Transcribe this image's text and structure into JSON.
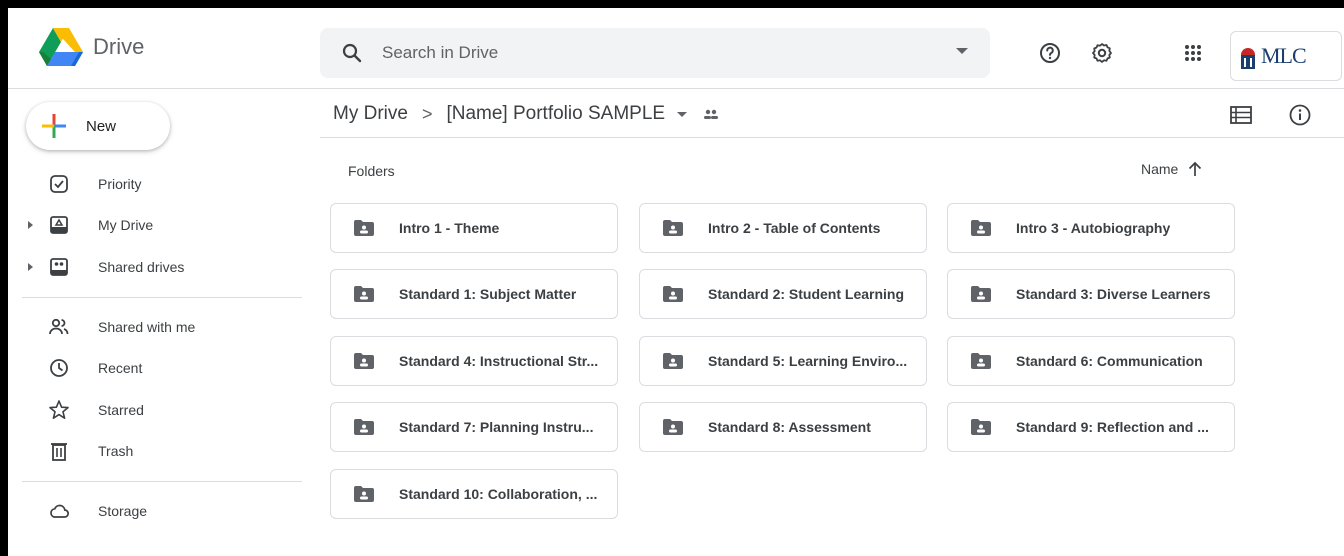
{
  "app": {
    "name": "Drive"
  },
  "search": {
    "placeholder": "Search in Drive"
  },
  "account": {
    "label": "MLC"
  },
  "new_button": {
    "label": "New"
  },
  "sidebar": {
    "items": [
      {
        "label": "Priority",
        "icon": "priority-icon"
      },
      {
        "label": "My Drive",
        "icon": "my-drive-icon"
      },
      {
        "label": "Shared drives",
        "icon": "shared-drives-icon"
      },
      {
        "label": "Shared with me",
        "icon": "shared-with-me-icon"
      },
      {
        "label": "Recent",
        "icon": "recent-icon"
      },
      {
        "label": "Starred",
        "icon": "star-icon"
      },
      {
        "label": "Trash",
        "icon": "trash-icon"
      },
      {
        "label": "Storage",
        "icon": "cloud-icon"
      }
    ]
  },
  "breadcrumb": {
    "root": "My Drive",
    "separator": ">",
    "current": "[Name] Portfolio SAMPLE"
  },
  "folders_section": {
    "title": "Folders",
    "sort_label": "Name"
  },
  "folders": [
    "Intro 1 - Theme",
    "Intro 2 - Table of Contents",
    "Intro 3 - Autobiography",
    "Standard 1: Subject Matter",
    "Standard 2: Student Learning",
    "Standard 3: Diverse Learners",
    "Standard 4: Instructional Str...",
    "Standard 5: Learning Enviro...",
    "Standard 6: Communication",
    "Standard 7: Planning Instru...",
    "Standard 8: Assessment",
    "Standard 9: Reflection and ...",
    "Standard 10: Collaboration, ..."
  ],
  "colors": {
    "text": "#3c4043",
    "icon": "#5f6368",
    "border": "#dadce0",
    "search_bg": "#f1f3f4"
  }
}
